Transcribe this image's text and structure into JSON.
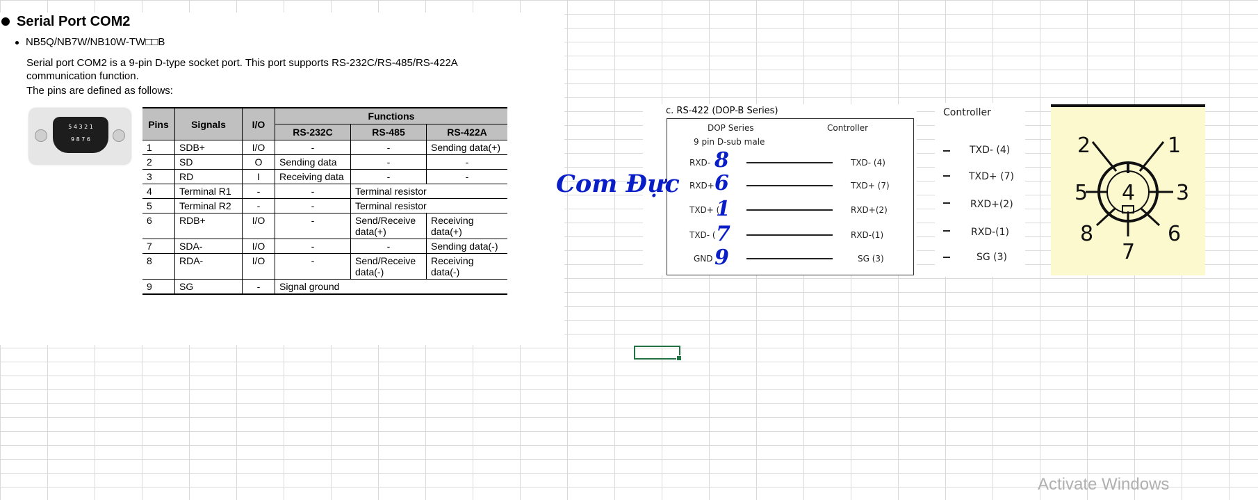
{
  "doc": {
    "heading": "Serial Port COM2",
    "model": "NB5Q/NB7W/NB10W-TW□□B",
    "para1": "Serial port COM2 is a 9-pin D-type socket port. This port supports RS-232C/RS-485/RS-422A",
    "para2": "communication function.",
    "para3": "The pins are defined as follows:"
  },
  "connector": {
    "row1": "5 4 3 2 1",
    "row2": "9 8 7 6"
  },
  "table": {
    "headers": {
      "pins": "Pins",
      "signals": "Signals",
      "io": "I/O",
      "functions": "Functions",
      "rs232": "RS-232C",
      "rs485": "RS-485",
      "rs422": "RS-422A"
    },
    "rows": [
      {
        "pin": "1",
        "signal": "SDB+",
        "io": "I/O",
        "rs232": "-",
        "rs485": "-",
        "rs422": "Sending data(+)"
      },
      {
        "pin": "2",
        "signal": "SD",
        "io": "O",
        "rs232": "Sending data",
        "rs485": "-",
        "rs422": "-"
      },
      {
        "pin": "3",
        "signal": "RD",
        "io": "I",
        "rs232": "Receiving data",
        "rs485": "-",
        "rs422": "-"
      },
      {
        "pin": "4",
        "signal": "Terminal R1",
        "io": "-",
        "rs232": "-",
        "merged": "Terminal resistor"
      },
      {
        "pin": "5",
        "signal": "Terminal R2",
        "io": "-",
        "rs232": "-",
        "merged": "Terminal resistor"
      },
      {
        "pin": "6",
        "signal": "RDB+",
        "io": "I/O",
        "rs232": "-",
        "rs485": "Send/Receive data(+)",
        "rs422": "Receiving data(+)"
      },
      {
        "pin": "7",
        "signal": "SDA-",
        "io": "I/O",
        "rs232": "-",
        "rs485": "-",
        "rs422": "Sending data(-)"
      },
      {
        "pin": "8",
        "signal": "RDA-",
        "io": "I/O",
        "rs232": "-",
        "rs485": "Send/Receive data(-)",
        "rs422": "Receiving data(-)"
      },
      {
        "pin": "9",
        "signal": "SG",
        "io": "-",
        "merged3": "Signal ground"
      }
    ]
  },
  "overlay_text": "Com Đực",
  "wiring": {
    "title": "c.  RS-422 (DOP-B Series)",
    "col_left": "DOP Series",
    "col_right": "Controller",
    "subtitle": "9 pin D-sub male",
    "rows": [
      {
        "left": "RXD-",
        "num": "8",
        "right": "TXD- (4)"
      },
      {
        "left": "RXD+",
        "num": "6",
        "right": "TXD+ (7)"
      },
      {
        "left": "TXD+ (",
        "num": "1",
        "right": "RXD+(2)"
      },
      {
        "left": "TXD- (",
        "num": "7",
        "right": "RXD-(1)"
      },
      {
        "left": "GND",
        "num": "9",
        "right": "SG (3)"
      }
    ]
  },
  "controller": {
    "title": "Controller",
    "rows": [
      "TXD- (4)",
      "TXD+ (7)",
      "RXD+(2)",
      "RXD-(1)",
      "SG (3)"
    ]
  },
  "din": {
    "pins": [
      "1",
      "2",
      "3",
      "4",
      "5",
      "6",
      "7",
      "8"
    ]
  },
  "activate": "Activate Windows"
}
